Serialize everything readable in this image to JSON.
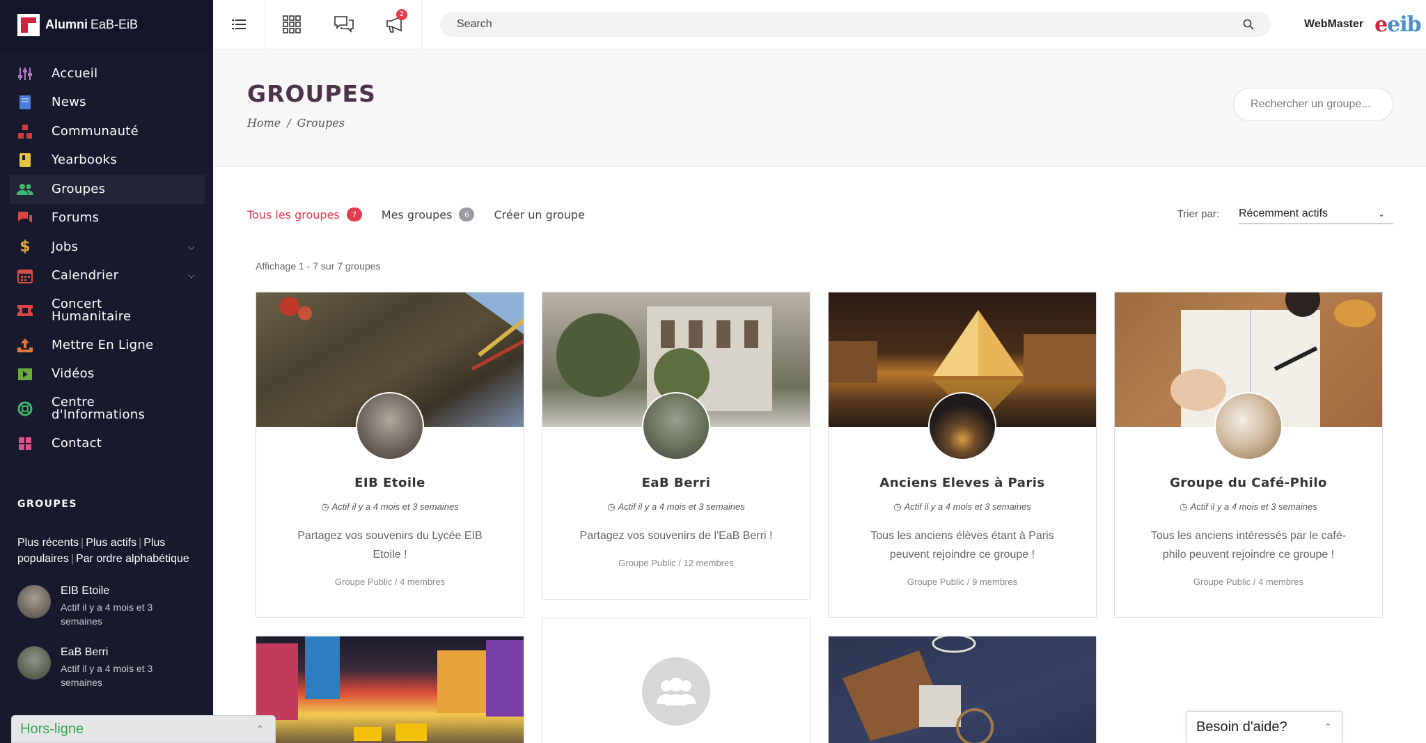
{
  "brand": {
    "name_bold": "Alumni",
    "name_light": "EaB-EiB"
  },
  "sidebar": {
    "items": [
      {
        "label": "Accueil",
        "icon": "sliders-icon",
        "color": "#b07cc6"
      },
      {
        "label": "News",
        "icon": "document-icon",
        "color": "#4c7cdc"
      },
      {
        "label": "Communauté",
        "icon": "community-icon",
        "color": "#d23b3b"
      },
      {
        "label": "Yearbooks",
        "icon": "book-icon",
        "color": "#e6c640"
      },
      {
        "label": "Groupes",
        "icon": "group-icon",
        "color": "#3fb86f"
      },
      {
        "label": "Forums",
        "icon": "chat-icon",
        "color": "#e04444"
      },
      {
        "label": "Jobs",
        "icon": "dollar-icon",
        "color": "#e0a53c"
      },
      {
        "label": "Calendrier",
        "icon": "calendar-icon",
        "color": "#d94c4c"
      },
      {
        "label": "Concert Humanitaire",
        "icon": "ticket-icon",
        "color": "#e04444"
      },
      {
        "label": "Mettre En Ligne",
        "icon": "upload-icon",
        "color": "#e0783c"
      },
      {
        "label": "Vidéos",
        "icon": "video-icon",
        "color": "#6aa83a"
      },
      {
        "label": "Centre d'Informations",
        "icon": "lifebuoy-icon",
        "color": "#3fb86f"
      },
      {
        "label": "Contact",
        "icon": "grid-icon",
        "color": "#e0508a"
      }
    ],
    "groups_title": "GROUPES",
    "sort_links": [
      "Plus récents",
      "Plus actifs",
      "Plus populaires",
      "Par ordre alphabétique"
    ],
    "groups": [
      {
        "name": "EIB Etoile",
        "meta": "Actif il y a 4 mois et 3 semaines"
      },
      {
        "name": "EaB Berri",
        "meta": "Actif il y a 4 mois et 3 semaines"
      }
    ]
  },
  "topbar": {
    "notification_count": "2",
    "search_placeholder": "Search",
    "user_name": "WebMaster",
    "logo_text": "eib"
  },
  "page": {
    "title": "GROUPES",
    "breadcrumb": [
      "Home",
      "Groupes"
    ],
    "group_search_placeholder": "Rechercher un groupe..."
  },
  "tabs": [
    {
      "label": "Tous les groupes",
      "count": "7"
    },
    {
      "label": "Mes groupes",
      "count": "6"
    },
    {
      "label": "Créer un groupe"
    }
  ],
  "sort": {
    "label": "Trier par:",
    "value": "Récemment actifs"
  },
  "count_text": "Affichage 1 - 7 sur 7 groupes",
  "cards": [
    {
      "title": "EIB Etoile",
      "active": "Actif il y a 4 mois et 3 semaines",
      "desc": "Partagez vos souvenirs du Lycée EIB Etoile !",
      "meta": "Groupe Public / 4 membres"
    },
    {
      "title": "EaB Berri",
      "active": "Actif il y a 4 mois et 3 semaines",
      "desc": "Partagez vos souvenirs de l'EaB Berri !",
      "meta": "Groupe Public / 12 membres"
    },
    {
      "title": "Anciens Eleves à Paris",
      "active": "Actif il y a 4 mois et 3 semaines",
      "desc": "Tous les anciens élèves étant à Paris peuvent rejoindre ce groupe !",
      "meta": "Groupe Public / 9 membres"
    },
    {
      "title": "Groupe du Café-Philo",
      "active": "Actif il y a 4 mois et 3 semaines",
      "desc": "Tous les anciens intéressés par le café-philo peuvent rejoindre ce groupe !",
      "meta": "Groupe Public / 4 membres"
    }
  ],
  "widgets": {
    "offline_label": "Hors-ligne",
    "help_label": "Besoin d'aide?"
  },
  "colors": {
    "accent": "#e5394d",
    "sidebar_bg": "#171a2c",
    "title": "#4d3249",
    "offline_green": "#34a853"
  }
}
